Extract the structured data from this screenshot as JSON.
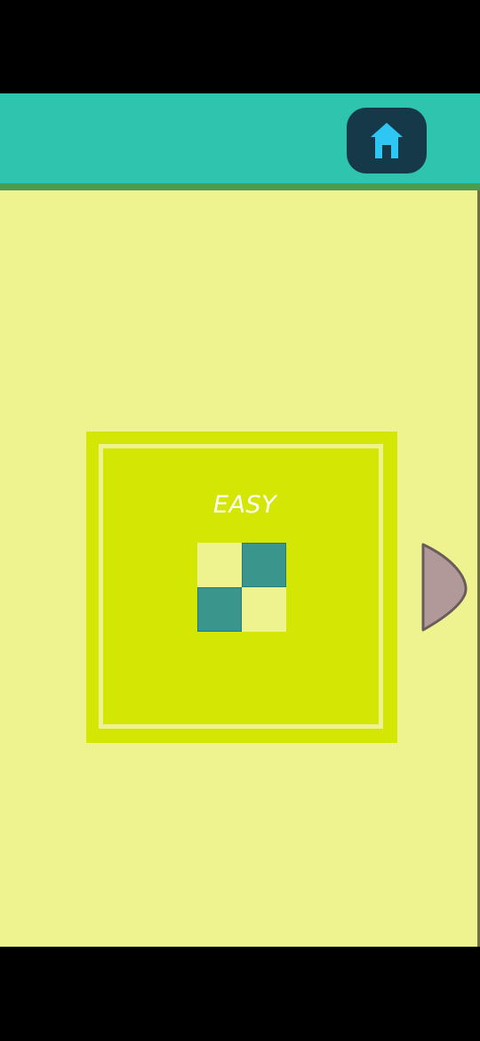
{
  "header": {
    "home_icon": "home-icon",
    "accent_color": "#2ec4ae",
    "stripe_color": "#4a9d4e"
  },
  "level_card": {
    "label": "EASY",
    "preview_grid": [
      [
        "light",
        "dark"
      ],
      [
        "dark",
        "light"
      ]
    ],
    "card_color": "#d3e604",
    "background_color": "#eef38f",
    "tile_dark_color": "#3a968c"
  },
  "navigation": {
    "next_icon": "next-arrow-icon",
    "next_color": "#b19999"
  }
}
